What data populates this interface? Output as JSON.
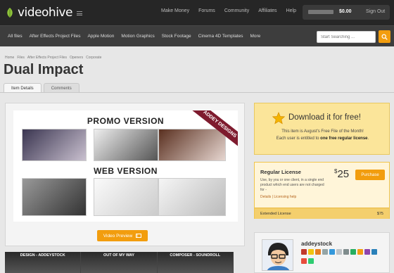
{
  "header": {
    "logo_text": "videohive",
    "nav": [
      "Make Money",
      "Forums",
      "Community",
      "Affiliates",
      "Help"
    ],
    "balance": "$0.00",
    "signout": "Sign Out"
  },
  "categories": [
    "All files",
    "After Effects Project Files",
    "Apple Motion",
    "Motion Graphics",
    "Stock Footage",
    "Cinema 4D Templates",
    "More"
  ],
  "search": {
    "placeholder": "Start Searching ..."
  },
  "breadcrumb": [
    "Home",
    "Files",
    "After Effects Project Files",
    "Openers",
    "Corporate"
  ],
  "page_title": "Dual Impact",
  "tabs": [
    "Item Details",
    "Comments"
  ],
  "preview": {
    "promo_label": "PROMO VERSION",
    "web_label": "WEB VERSION",
    "ribbon": "ADDEY DESIGNS",
    "button_label": "Video Preview"
  },
  "strip": [
    "DESIGN - ADDEYSTOCK",
    "OUT OF MY WAY",
    "COMPOSER - SOUNDROLL"
  ],
  "free_file": {
    "title": "Download it for free!",
    "line1": "This item is August's Free File of the Month!",
    "line2_prefix": "Each user is entitled to ",
    "line2_bold": "one free regular license",
    "line2_suffix": "."
  },
  "license": {
    "title": "Regular License",
    "description": "Use, by you or one client, in a single end product which end users are not charged for -",
    "links": "Details | Licensing help",
    "currency": "$",
    "price": "25",
    "purchase_label": "Purchase",
    "extended_label": "Extended License",
    "extended_price": "$75"
  },
  "author": {
    "name": "addeystock"
  },
  "colors": {
    "accent": "#f29d0e",
    "topbar": "#262626",
    "catbar": "#3d3d3d",
    "free_bg": "#fbe59a",
    "ribbon": "#7e1b2e"
  }
}
